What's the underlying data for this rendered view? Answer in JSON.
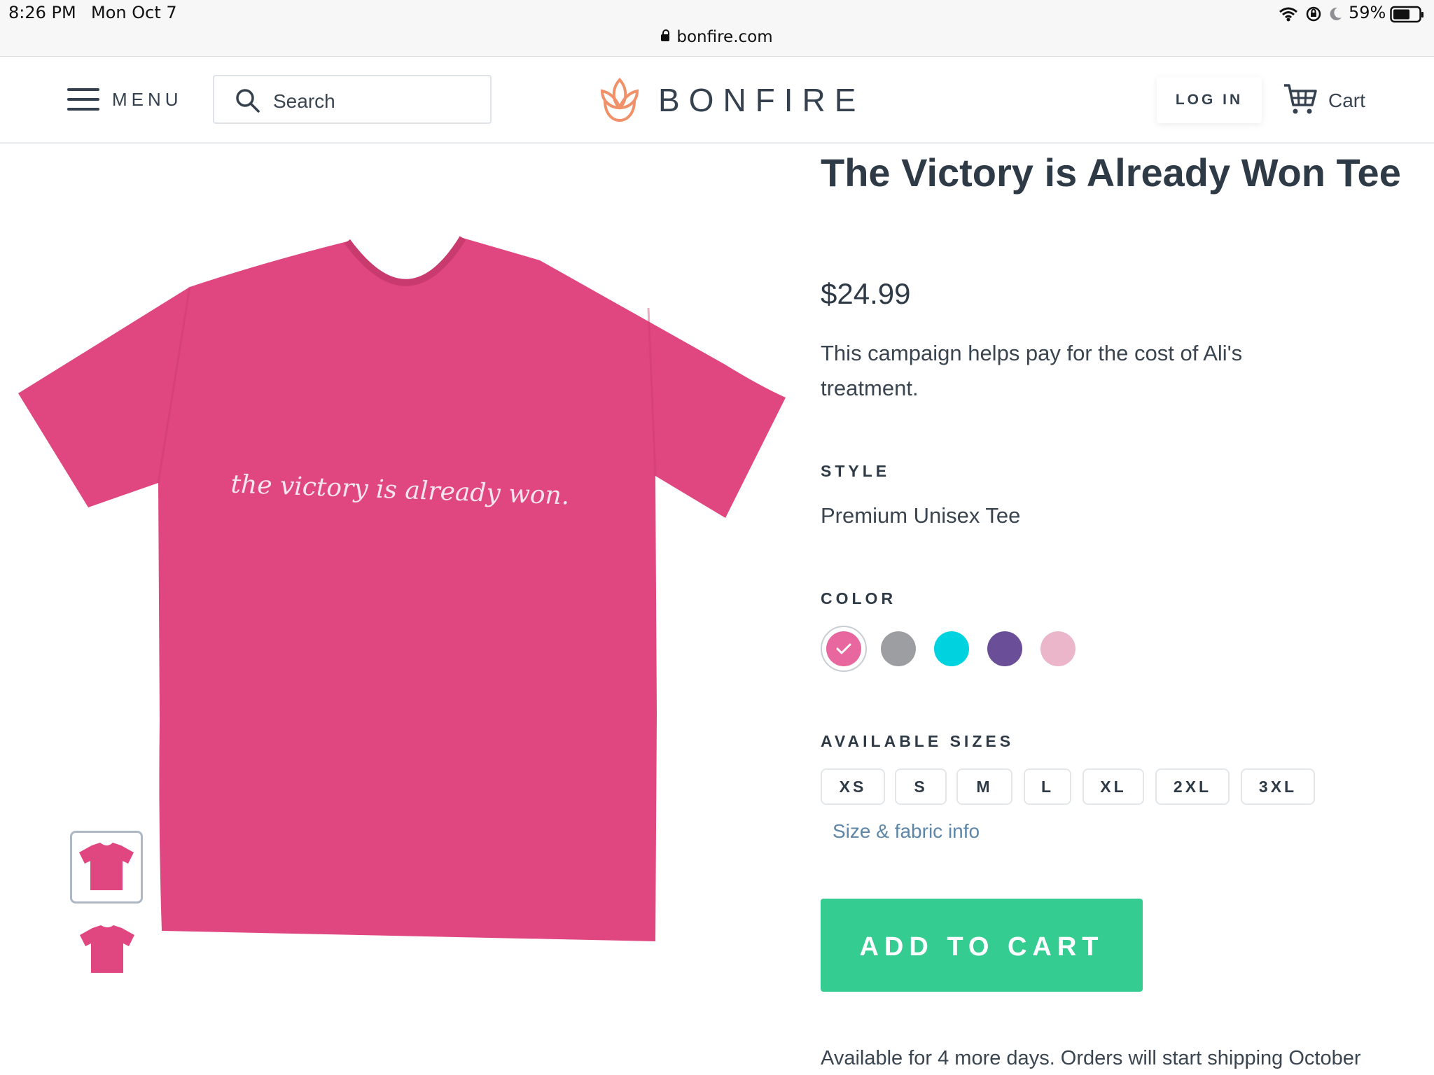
{
  "status_bar": {
    "time": "8:26 PM",
    "date": "Mon Oct 7",
    "battery": "59%",
    "url": "bonfire.com",
    "icons": [
      "wifi-icon",
      "orientation-lock-icon",
      "moon-icon",
      "battery-icon",
      "lock-icon"
    ]
  },
  "header": {
    "menu_label": "MENU",
    "search_placeholder": "Search",
    "brand": "BONFIRE",
    "login_label": "LOG IN",
    "cart_label": "Cart",
    "icons": [
      "hamburger-icon",
      "search-icon",
      "bonfire-logo-icon",
      "cart-icon"
    ]
  },
  "product": {
    "title": "The Victory is Already Won Tee",
    "price": "$24.99",
    "description": "This campaign helps pay for the cost of Ali's treatment.",
    "image_caption": "the victory is already won.",
    "style_label": "STYLE",
    "style_value": "Premium Unisex Tee",
    "color_label": "COLOR",
    "colors": [
      {
        "name": "pink",
        "hex": "#e8679f",
        "selected": true
      },
      {
        "name": "gray",
        "hex": "#9d9ea2",
        "selected": false
      },
      {
        "name": "cyan",
        "hex": "#00d3e0",
        "selected": false
      },
      {
        "name": "purple",
        "hex": "#6a4f98",
        "selected": false
      },
      {
        "name": "light-pink",
        "hex": "#ebb5ca",
        "selected": false
      }
    ],
    "sizes_label": "AVAILABLE SIZES",
    "sizes": [
      "XS",
      "S",
      "M",
      "L",
      "XL",
      "2XL",
      "3XL"
    ],
    "size_info_link": "Size & fabric info",
    "add_to_cart_label": "ADD TO CART",
    "availability": "Available for 4 more days. Orders will start shipping October"
  },
  "theme": {
    "accent_green": "#34cc91",
    "shirt_color": "#e0467f",
    "text_dark": "#2f3a47",
    "link_color": "#5e86a8",
    "logo_orange": "#f0916a"
  }
}
